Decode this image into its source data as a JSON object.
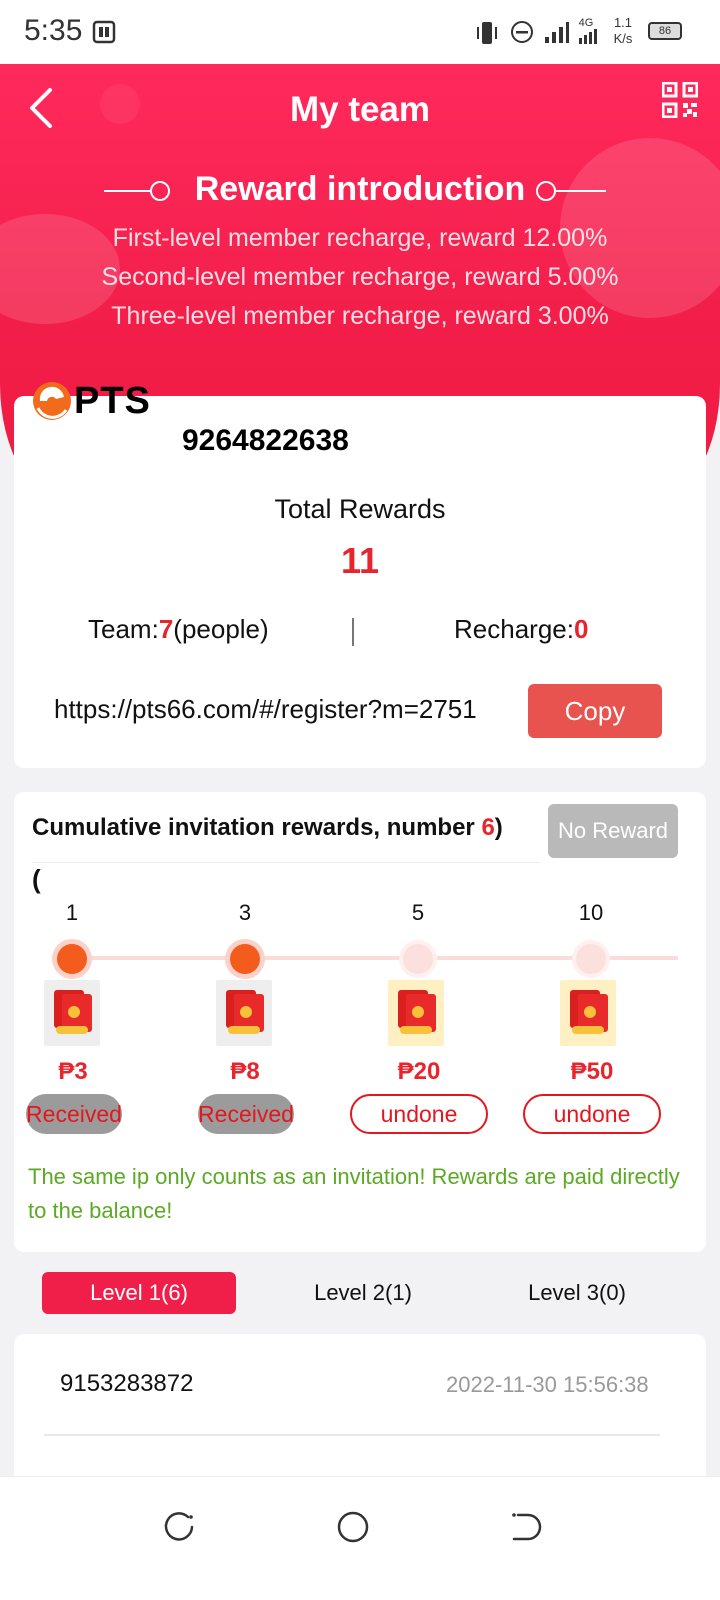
{
  "status_bar": {
    "time": "5:35",
    "speed_value": "1.1",
    "speed_unit": "K/s",
    "network": "4G",
    "battery": "86"
  },
  "header": {
    "title": "My team",
    "intro_title": "Reward introduction",
    "rules": [
      "First-level member recharge, reward 12.00%",
      "Second-level member recharge, reward 5.00%",
      "Three-level member recharge, reward 3.00%"
    ]
  },
  "account": {
    "logo_text": "PTS",
    "id": "9264822638",
    "total_label": "Total Rewards",
    "total_value": "11",
    "team_prefix": "Team:",
    "team_count": "7",
    "team_suffix": "(people)",
    "recharge_prefix": "Recharge:",
    "recharge_value": "0",
    "invite_link": "https://pts66.com/#/register?m=2751",
    "copy_label": "Copy"
  },
  "invitation": {
    "title_prefix": "Cumulative invitation rewards, number ",
    "number": "6",
    "title_suffix": ")",
    "paren": "(",
    "no_reward_label": "No Reward",
    "milestones": [
      {
        "count": "1",
        "amount": "₱3",
        "status": "Received"
      },
      {
        "count": "3",
        "amount": "₱8",
        "status": "Received"
      },
      {
        "count": "5",
        "amount": "₱20",
        "status": "undone"
      },
      {
        "count": "10",
        "amount": "₱50",
        "status": "undone"
      }
    ],
    "notice": "The same ip only counts as an invitation! Rewards are paid directly to the balance!"
  },
  "tabs": [
    {
      "label": "Level 1(6)",
      "active": true
    },
    {
      "label": "Level 2(1)",
      "active": false
    },
    {
      "label": "Level 3(0)",
      "active": false
    }
  ],
  "members": [
    {
      "id": "9153283872",
      "time": "2022-11-30 15:56:38"
    }
  ],
  "colors": {
    "accent": "#f01f4a",
    "reward_red": "#e6252f",
    "notice_green": "#5ca925",
    "copy_button": "#e85350"
  }
}
